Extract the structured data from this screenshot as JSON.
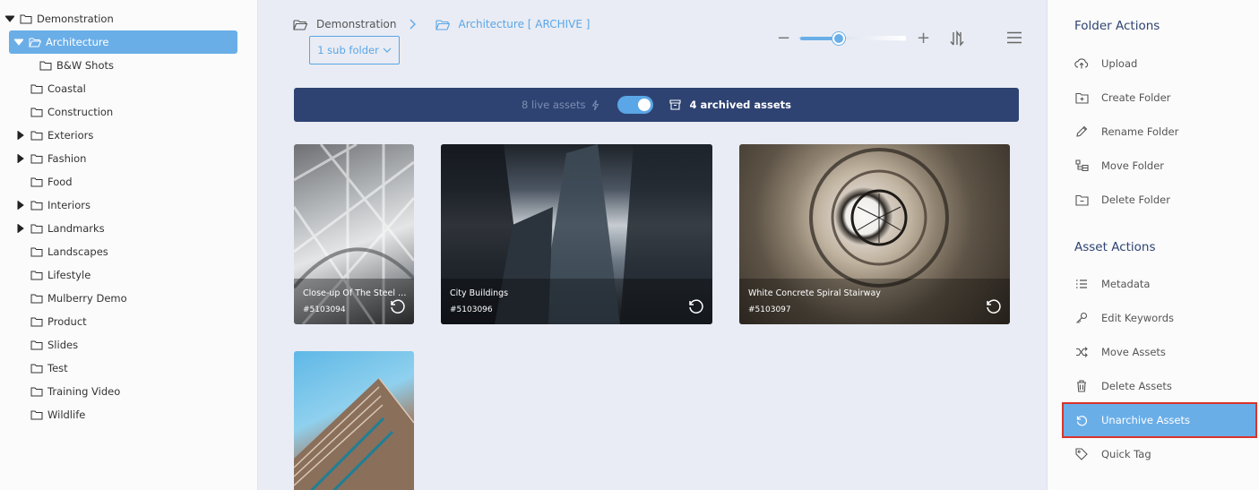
{
  "tree": {
    "root": "Demonstration",
    "selected": "Architecture",
    "items": [
      {
        "label": "B&W Shots",
        "expandable": false
      },
      {
        "label": "Coastal",
        "expandable": false
      },
      {
        "label": "Construction",
        "expandable": false
      },
      {
        "label": "Exteriors",
        "expandable": true
      },
      {
        "label": "Fashion",
        "expandable": true
      },
      {
        "label": "Food",
        "expandable": false
      },
      {
        "label": "Interiors",
        "expandable": true
      },
      {
        "label": "Landmarks",
        "expandable": true
      },
      {
        "label": "Landscapes",
        "expandable": false
      },
      {
        "label": "Lifestyle",
        "expandable": false
      },
      {
        "label": "Mulberry Demo",
        "expandable": false
      },
      {
        "label": "Product",
        "expandable": false
      },
      {
        "label": "Slides",
        "expandable": false
      },
      {
        "label": "Test",
        "expandable": false
      },
      {
        "label": "Training Video",
        "expandable": false
      },
      {
        "label": "Wildlife",
        "expandable": false
      }
    ]
  },
  "breadcrumb": {
    "root": "Demonstration",
    "current": "Architecture [ ARCHIVE ]"
  },
  "subfolder_button": "1 sub folder",
  "zoom": {
    "minus": "−",
    "plus": "+",
    "level": 0.35
  },
  "banner": {
    "live": "8 live assets",
    "archived": "4 archived assets",
    "toggle_on": true
  },
  "assets": [
    {
      "title": "Close-up Of The Steel Fr...",
      "code": "#5103094"
    },
    {
      "title": "City Buildings",
      "code": "#5103096"
    },
    {
      "title": "White Concrete Spiral Stairway",
      "code": "#5103097"
    },
    {
      "title": "",
      "code": ""
    }
  ],
  "actions": {
    "folder_heading": "Folder Actions",
    "folder": [
      "Upload",
      "Create Folder",
      "Rename Folder",
      "Move Folder",
      "Delete Folder"
    ],
    "asset_heading": "Asset Actions",
    "asset": [
      "Metadata",
      "Edit Keywords",
      "Move Assets",
      "Delete Assets",
      "Unarchive Assets",
      "Quick Tag"
    ]
  },
  "colors": {
    "accent": "#6aaee8",
    "banner": "#2e4372",
    "highlight_outline": "#d9342b"
  }
}
